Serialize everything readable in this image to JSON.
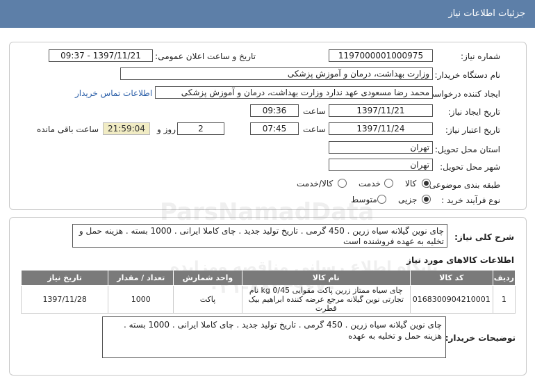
{
  "header": {
    "title": "جزئیات اطلاعات نیاز"
  },
  "form": {
    "need_number_label": "شماره نیاز:",
    "need_number": "1197000001000975",
    "announce_label": "تاریخ و ساعت اعلان عمومی:",
    "announce_value": "1397/11/21 - 09:37",
    "buyer_org_label": "نام دستگاه خریدار:",
    "buyer_org": "وزارت بهداشت، درمان و آموزش پزشکی",
    "requester_label": "ایجاد کننده درخواست:",
    "requester": "محمد رضا مسعودی عهد ندارد وزارت بهداشت، درمان و آموزش پزشکی",
    "contact_link": "اطلاعات تماس خریدار",
    "created_label": "تاریخ ایجاد نیاز:",
    "created_date": "1397/11/21",
    "time_label": "ساعت",
    "created_time": "09:36",
    "valid_label": "تاریخ اعتبار نیاز:",
    "valid_date": "1397/11/24",
    "valid_time": "07:45",
    "days_value": "2",
    "days_label": "روز و",
    "remaining_time": "21:59:04",
    "remaining_label": "ساعت باقی مانده",
    "province_label": "استان محل تحویل:",
    "province": "تهران",
    "city_label": "شهر محل تحویل:",
    "city": "تهران",
    "category_label": "طبقه بندی موضوعی:",
    "category_options": [
      "کالا",
      "خدمت",
      "کالا/خدمت"
    ],
    "process_label": "نوع فرآیند خرید :",
    "process_options": [
      "جزیی",
      "متوسط"
    ]
  },
  "description": {
    "label": "شرح کلی نیاز:",
    "text": "چای نوین گیلانه سیاه زرین . 450 گرمی . تاریخ تولید جدید . چای کاملا ایرانی . 1000 بسته . هزینه حمل و تخلیه به عهده فروشنده است"
  },
  "items_section": {
    "title": "اطلاعات کالاهای مورد نیاز",
    "columns": [
      "ردیف",
      "کد کالا",
      "نام کالا",
      "واحد شمارش",
      "تعداد / مقدار",
      "تاریخ نیاز"
    ],
    "rows": [
      {
        "row": "1",
        "code": "0168300904210001",
        "name": "چای سیاه ممتاز زرین پاکت مقوایی 0/45 kg نام تجارتی نوین گیلانه مرجع عرضه کننده ابراهیم بیک قطرت",
        "unit": "پاکت",
        "qty": "1000",
        "date": "1397/11/28"
      }
    ]
  },
  "buyer_notes": {
    "label": "توضیحات خریدار:",
    "text": "چای نوین گیلانه سیاه زرین . 450 گرمی . تاریخ تولید جدید . چای کاملا ایرانی . 1000 بسته . هزینه حمل و تخلیه به عهده"
  },
  "watermark": {
    "latin": "ParsNamadData",
    "persian": "پایگاه اطلاع رسانی مناقصه ومزایده",
    "phone": "۰۲۱-۸۸۳۴۹۶۷۰"
  }
}
